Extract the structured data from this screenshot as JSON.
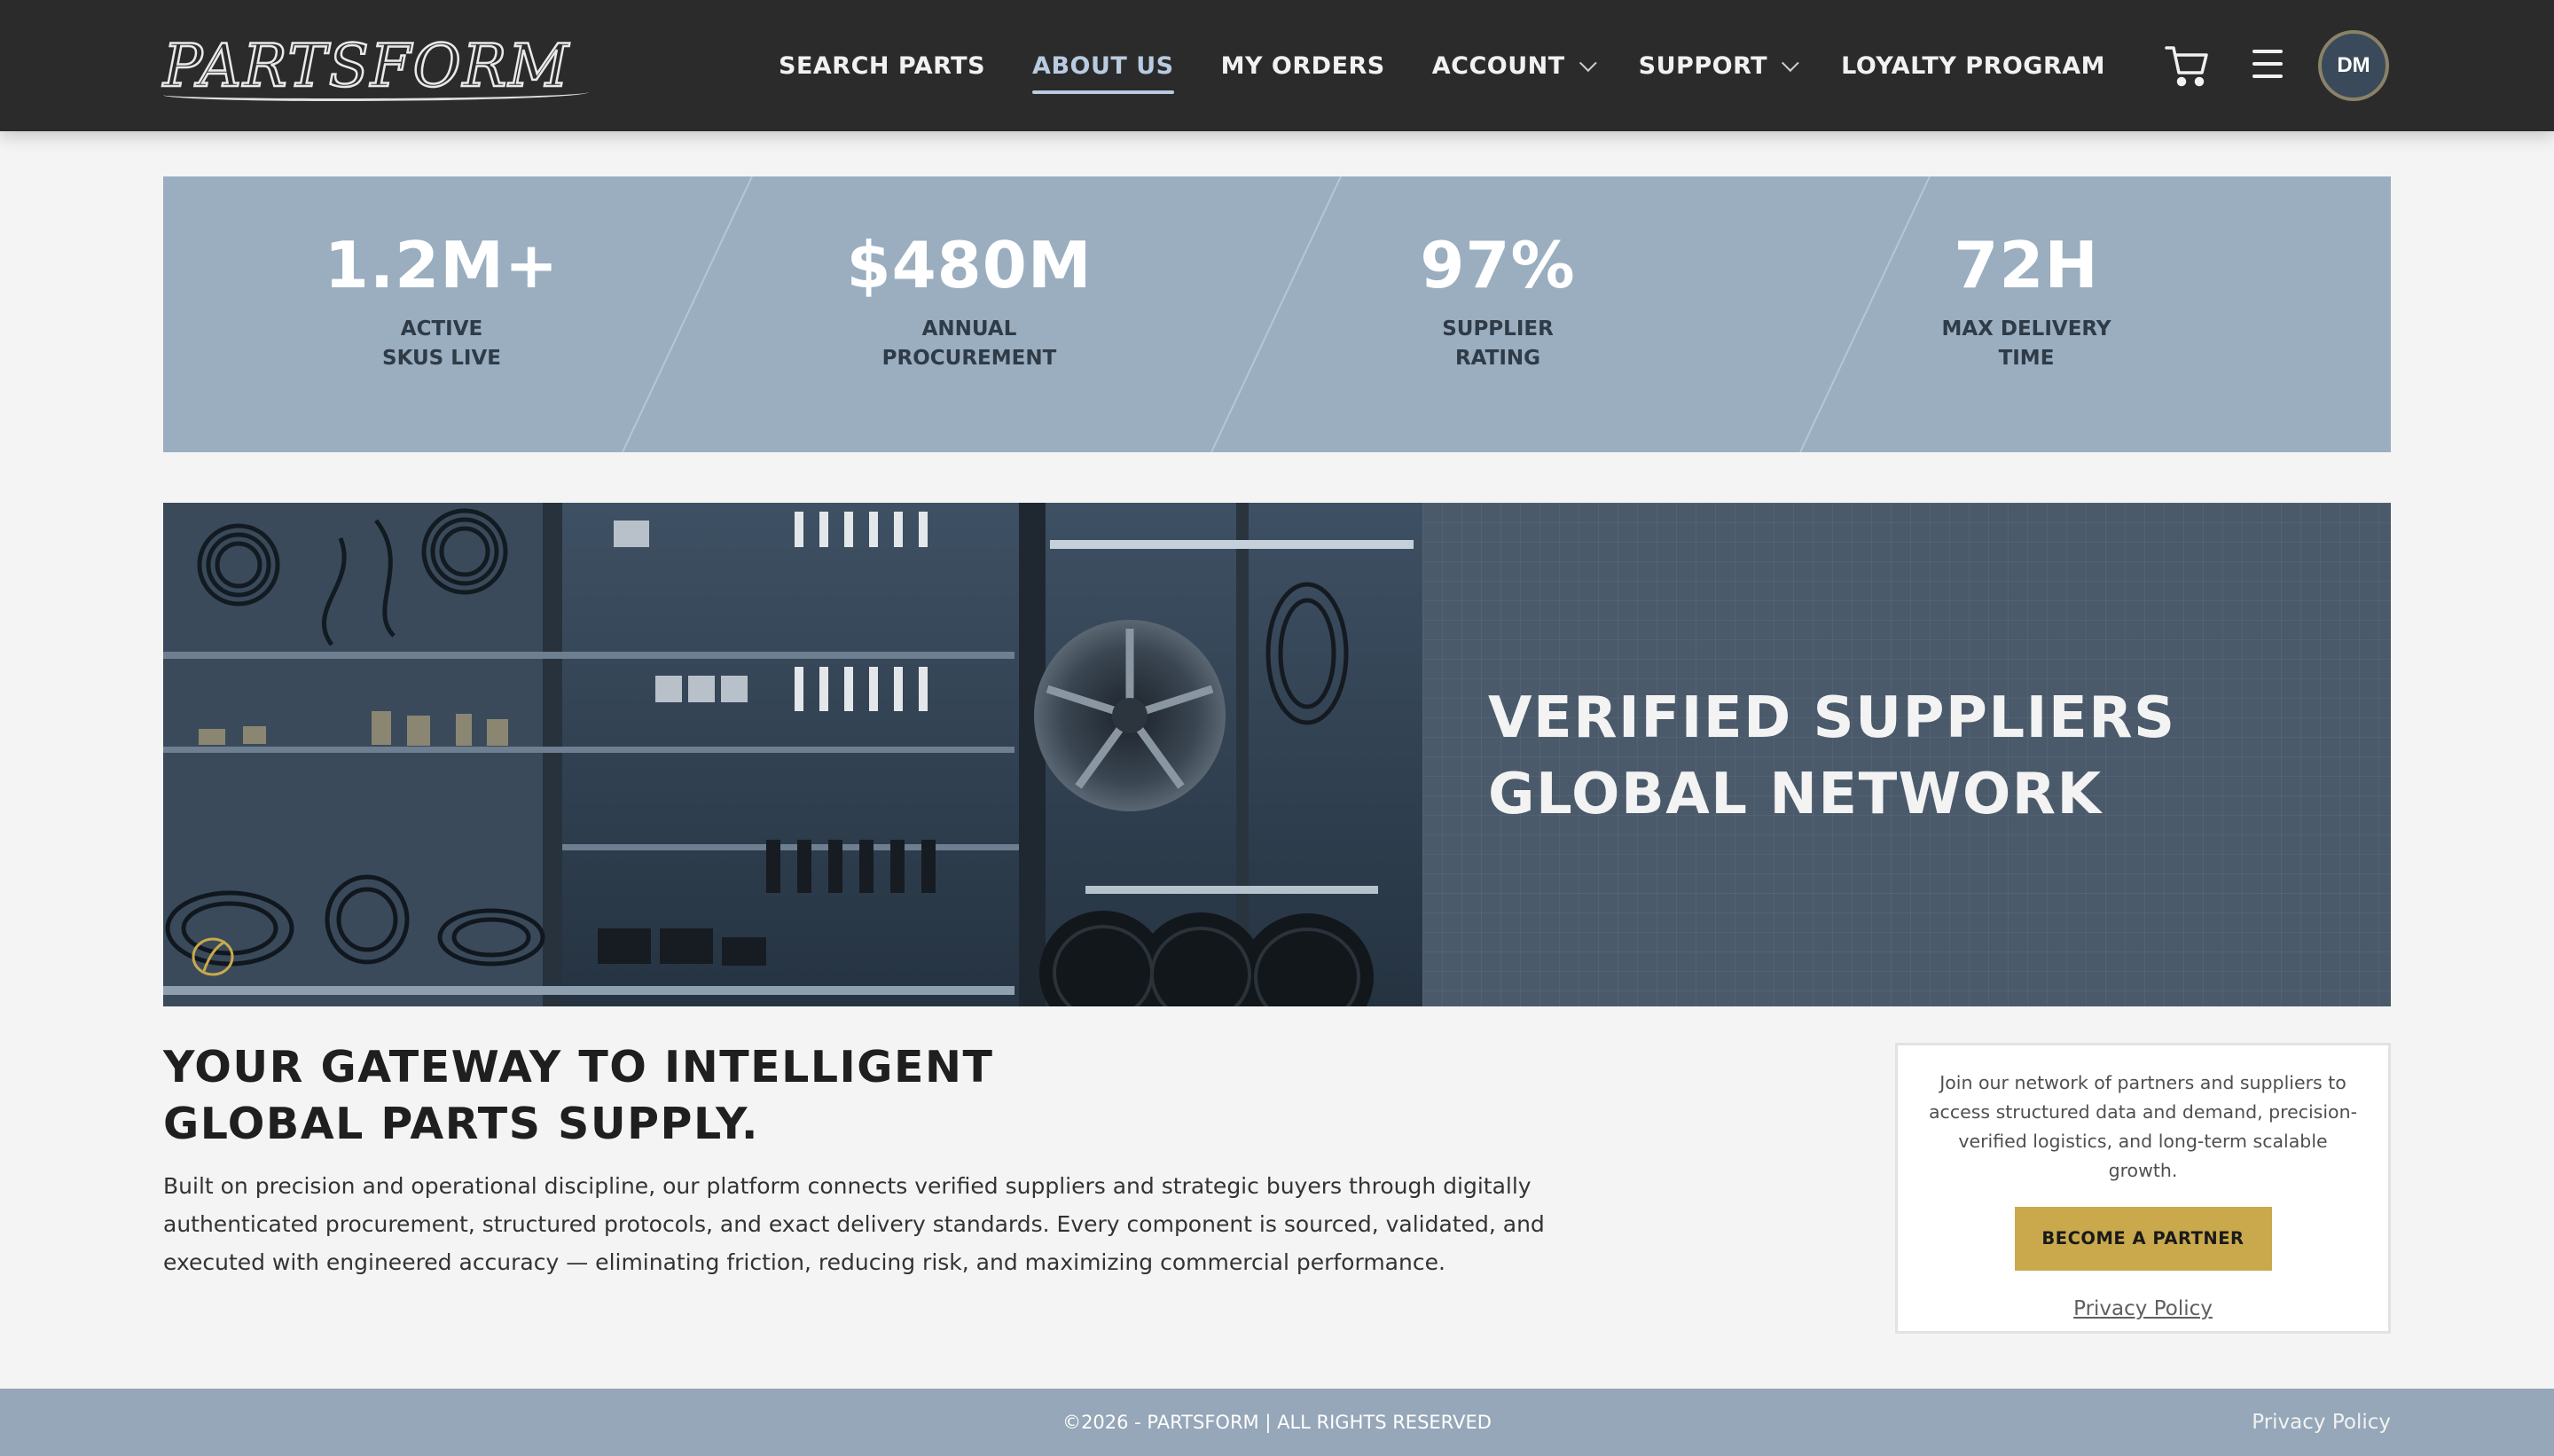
{
  "header": {
    "logo_text": "PARTSFORM",
    "nav": [
      {
        "label": "SEARCH PARTS",
        "active": false,
        "dropdown": false
      },
      {
        "label": "ABOUT US",
        "active": true,
        "dropdown": false
      },
      {
        "label": "MY ORDERS",
        "active": false,
        "dropdown": false
      },
      {
        "label": "ACCOUNT",
        "active": false,
        "dropdown": true
      },
      {
        "label": "SUPPORT",
        "active": false,
        "dropdown": true
      },
      {
        "label": "LOYALTY PROGRAM",
        "active": false,
        "dropdown": false
      }
    ],
    "icons": {
      "cart": "cart-icon",
      "menu": "hamburger-menu-icon"
    },
    "avatar_initials": "DM"
  },
  "stats": [
    {
      "value": "1.2M+",
      "label": "ACTIVE\nSKUS LIVE"
    },
    {
      "value": "$480M",
      "label": "ANNUAL\nPROCUREMENT"
    },
    {
      "value": "97%",
      "label": "SUPPLIER\nRATING"
    },
    {
      "value": "72H",
      "label": "MAX DELIVERY\nTIME"
    }
  ],
  "hero": {
    "title_line1": "VERIFIED SUPPLIERS",
    "title_line2": "GLOBAL NETWORK"
  },
  "gateway": {
    "title_line1": "YOUR GATEWAY TO INTELLIGENT",
    "title_line2": "GLOBAL PARTS SUPPLY.",
    "body": "Built on precision and operational discipline, our platform connects verified suppliers and strategic buyers through digitally authenticated procurement, structured protocols, and exact delivery standards. Every component is sourced, validated, and executed with engineered accuracy — eliminating friction, reducing risk, and maximizing commercial performance."
  },
  "partner": {
    "text": "Join our network of partners and suppliers to access structured data and demand, precision-verified logistics, and long-term scalable growth.",
    "button_label": "BECOME A PARTNER",
    "privacy_link": "Privacy Policy"
  },
  "footer": {
    "copyright": "©2026 - PARTSFORM | ALL RIGHTS RESERVED",
    "privacy_link": "Privacy Policy"
  },
  "colors": {
    "header_bg": "#2b2b2b",
    "nav_active": "#b8cbe0",
    "stats_bg": "#9aaec0",
    "hero_panel_bg": "#4a5a6a",
    "accent_gold": "#c9a94c",
    "footer_bg": "#95a7b8",
    "page_bg": "#f4f4f4"
  }
}
